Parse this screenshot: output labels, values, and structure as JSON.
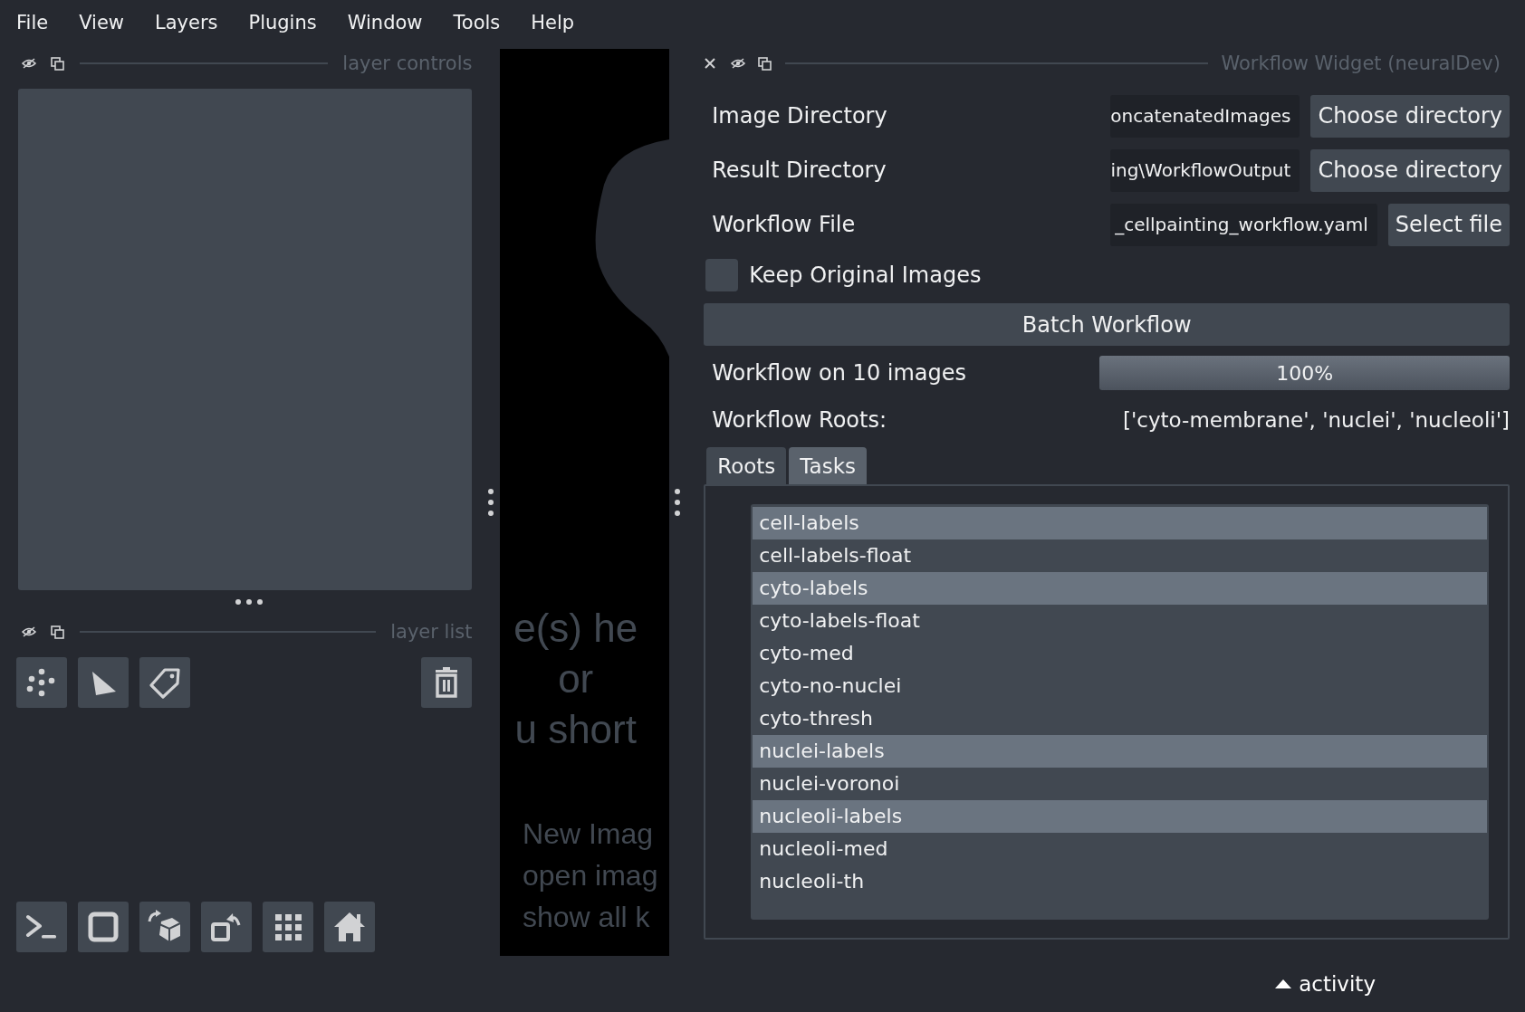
{
  "menu": [
    {
      "label": "File"
    },
    {
      "label": "View"
    },
    {
      "label": "Layers"
    },
    {
      "label": "Plugins"
    },
    {
      "label": "Window"
    },
    {
      "label": "Tools"
    },
    {
      "label": "Help"
    }
  ],
  "layer_controls": {
    "title": "layer controls"
  },
  "layer_list": {
    "title": "layer list"
  },
  "canvas": {
    "welcome_lines": [
      {
        "text": "e(s) he",
        "kind": "heading"
      },
      {
        "text": "or",
        "kind": "heading"
      },
      {
        "text": "u short",
        "kind": "heading"
      },
      {
        "text": "New Imag",
        "kind": "hint"
      },
      {
        "text": "open imag",
        "kind": "hint"
      },
      {
        "text": "show all k",
        "kind": "hint"
      }
    ]
  },
  "widget": {
    "title": "Workflow Widget (neuralDev)",
    "fields": [
      {
        "label": "Image Directory",
        "value": "oncatenatedImages",
        "button": "Choose directory"
      },
      {
        "label": "Result Directory",
        "value": "ing\\WorkflowOutput",
        "button": "Choose directory"
      },
      {
        "label": "Workflow File",
        "value": "_cellpainting_workflow.yaml",
        "button": "Select file"
      }
    ],
    "keep_original": {
      "label": "Keep Original Images",
      "checked": false
    },
    "batch_button": "Batch Workflow",
    "progress": {
      "label": "Workflow on 10 images",
      "level": 1,
      "reading": "100%"
    },
    "roots": {
      "label": "Workflow Roots:",
      "value": "['cyto-membrane', 'nuclei', 'nucleoli']"
    },
    "tabs": [
      {
        "label": "Roots",
        "selected": false
      },
      {
        "label": "Tasks",
        "selected": true
      }
    ],
    "tasks": [
      {
        "label": "cell-labels",
        "selected": true
      },
      {
        "label": "cell-labels-float",
        "selected": false
      },
      {
        "label": "cyto-labels",
        "selected": true
      },
      {
        "label": "cyto-labels-float",
        "selected": false
      },
      {
        "label": "cyto-med",
        "selected": false
      },
      {
        "label": "cyto-no-nuclei",
        "selected": false
      },
      {
        "label": "cyto-thresh",
        "selected": false
      },
      {
        "label": "nuclei-labels",
        "selected": true
      },
      {
        "label": "nuclei-voronoi",
        "selected": false
      },
      {
        "label": "nucleoli-labels",
        "selected": true
      },
      {
        "label": "nucleoli-med",
        "selected": false
      },
      {
        "label": "nucleoli-th",
        "selected": false
      }
    ]
  },
  "activity": {
    "label": "activity"
  }
}
